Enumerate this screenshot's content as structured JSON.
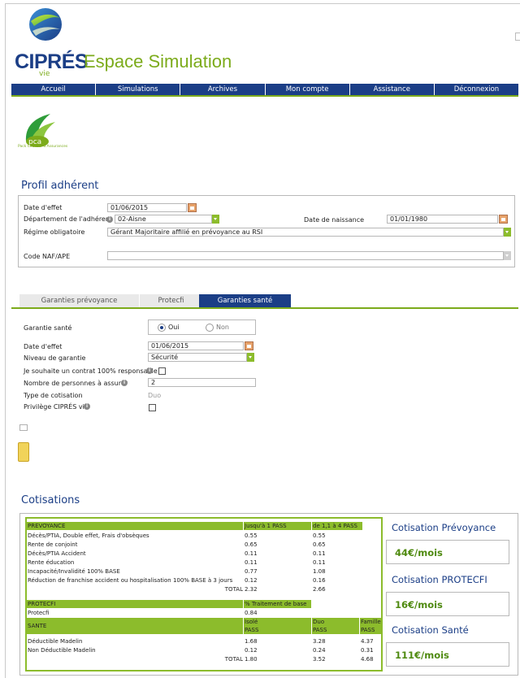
{
  "brand": {
    "name": "CIPRÉS",
    "sub": "vie",
    "app_title": "Espace Simulation",
    "colors": {
      "navy": "#1b3e86",
      "green": "#7cab1b",
      "header_green": "#8cbc2c"
    }
  },
  "nav": {
    "items": [
      "Accueil",
      "Simulations",
      "Archives",
      "Mon compte",
      "Assistance",
      "Déconnexion"
    ]
  },
  "partner": {
    "name": "pca",
    "caption": "Pack Courtier d'Assurances"
  },
  "profil": {
    "title": "Profil adhérent",
    "date_effet_label": "Date d'effet",
    "date_effet_value": "01/06/2015",
    "departement_label": "Département de l'adhérent",
    "departement_value": "02-Aisne",
    "date_naissance_label": "Date de naissance",
    "date_naissance_value": "01/01/1980",
    "regime_label": "Régime obligatoire",
    "regime_value": "Gérant Majoritaire affilié en prévoyance au RSI",
    "naf_label": "Code NAF/APE",
    "naf_value": ""
  },
  "tabs": [
    "Garanties prévoyance",
    "Protecfi",
    "Garanties santé"
  ],
  "sante": {
    "garantie_label": "Garantie santé",
    "oui": "Oui",
    "non": "Non",
    "date_effet_label": "Date d'effet",
    "date_effet_value": "01/06/2015",
    "niveau_label": "Niveau de garantie",
    "niveau_value": "Sécurité",
    "contrat_label": "Je souhaite un contrat 100% responsable",
    "nb_personnes_label": "Nombre de personnes à assurer",
    "nb_personnes_value": "2",
    "type_label": "Type de cotisation",
    "type_value": "Duo",
    "privilege_label": "Privilège CIPRÉS vie"
  },
  "cotisations": {
    "title": "Cotisations",
    "prevoyance": {
      "header": [
        "PREVOYANCE",
        "Jusqu'à 1 PASS",
        "de 1,1 à 4 PASS"
      ],
      "rows": [
        [
          "Décès/PTIA, Double effet, Frais d'obsèques",
          "0.55",
          "0.55"
        ],
        [
          "Rente de conjoint",
          "0.65",
          "0.65"
        ],
        [
          "Décès/PTIA Accident",
          "0.11",
          "0.11"
        ],
        [
          "Rente éducation",
          "0.11",
          "0.11"
        ],
        [
          "Incapacité/Invalidité 100% BASE",
          "0.77",
          "1.08"
        ],
        [
          "Réduction de franchise accident ou hospitalisation 100% BASE à 3 jours",
          "0.12",
          "0.16"
        ]
      ],
      "total_label": "TOTAL",
      "total_values": [
        "2.32",
        "2.66"
      ]
    },
    "protecfi": {
      "header": [
        "PROTECFI",
        "% Traitement de base"
      ],
      "rows": [
        [
          "Protecfi",
          "0.84"
        ]
      ]
    },
    "sante": {
      "header": [
        "SANTE",
        "Isolé",
        "Duo",
        "Famille"
      ],
      "subheader": [
        "PASS",
        "PASS",
        "PASS"
      ],
      "rows": [
        [
          "Déductible Madelin",
          "1.68",
          "3.28",
          "4.37"
        ],
        [
          "Non Déductible Madelin",
          "0.12",
          "0.24",
          "0.31"
        ]
      ],
      "total_label": "TOTAL",
      "total_values": [
        "1.80",
        "3.52",
        "4.68"
      ]
    },
    "summary": [
      {
        "label": "Cotisation Prévoyance",
        "value": "44€/mois"
      },
      {
        "label": "Cotisation PROTECFI",
        "value": "16€/mois"
      },
      {
        "label": "Cotisation Santé",
        "value": "111€/mois"
      }
    ]
  }
}
